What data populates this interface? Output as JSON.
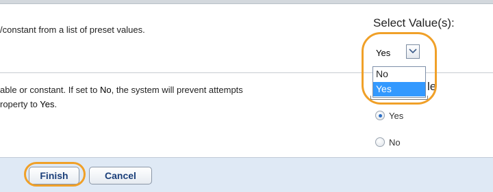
{
  "rows": [
    {
      "description_parts": [
        "/constant from a list of preset values."
      ]
    },
    {
      "description_line1_parts": [
        "able or constant. If set to ",
        "No",
        ", the system will prevent attempts"
      ],
      "description_line2_parts": [
        "roperty to ",
        "Yes",
        "."
      ]
    }
  ],
  "select": {
    "heading": "Select Value(s):",
    "current_value": "Yes",
    "options": [
      "No",
      "Yes"
    ],
    "selected_option": "Yes"
  },
  "partial_label": "le",
  "radio": {
    "options": [
      {
        "label": "Yes",
        "checked": true
      },
      {
        "label": "No",
        "checked": false
      }
    ]
  },
  "footer": {
    "finish_label": "Finish",
    "cancel_label": "Cancel"
  },
  "colors": {
    "highlight": "#f0a028",
    "selection": "#3399ff",
    "footer_bg": "#dfe9f5",
    "button_text": "#1b3f7a"
  }
}
